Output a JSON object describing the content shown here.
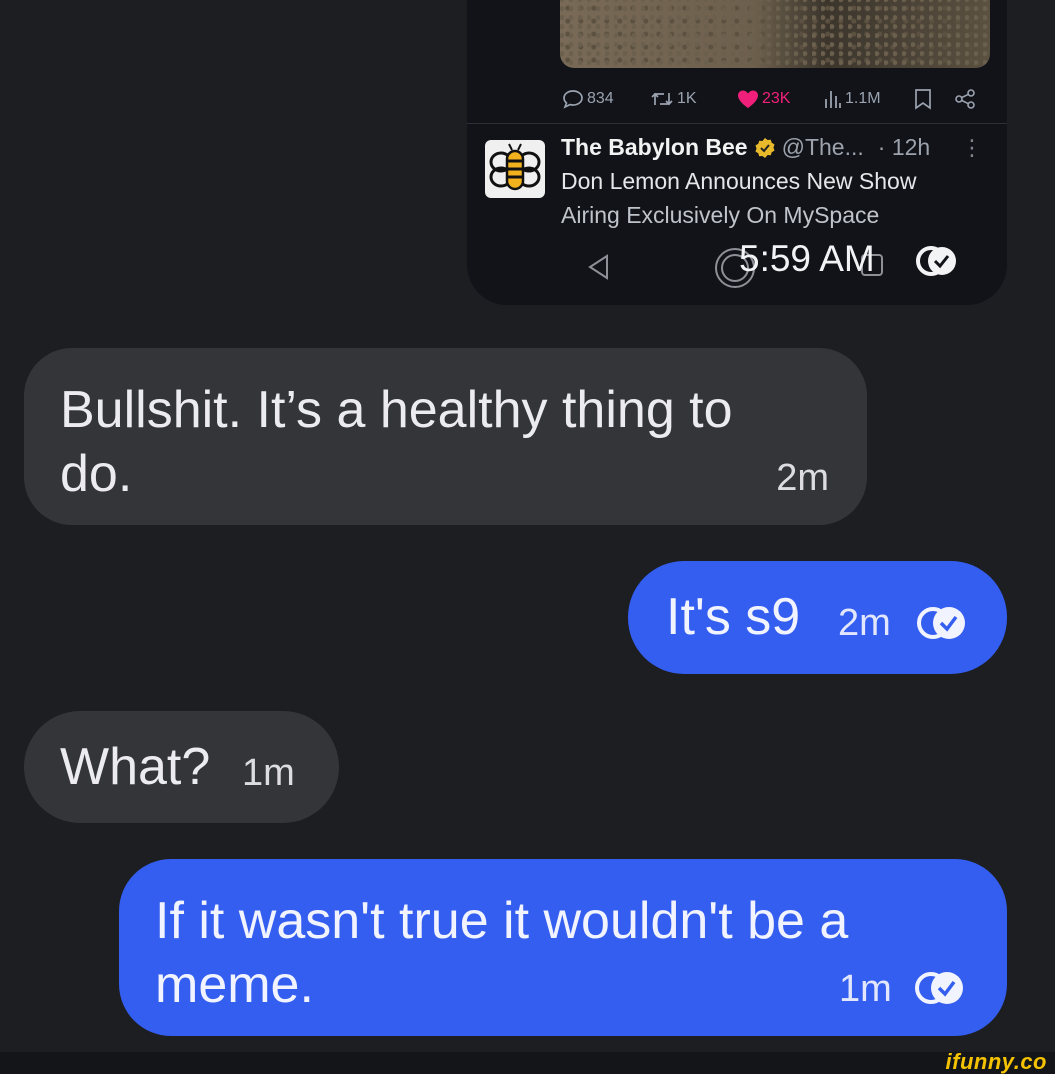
{
  "screenshot_tweet": {
    "engagement": {
      "replies": "834",
      "reposts": "1K",
      "likes": "23K",
      "views": "1.1M"
    },
    "author_name": "The Babylon Bee",
    "author_handle": "@The...",
    "age": "· 12h",
    "more": "⋮",
    "text_line1": "Don Lemon Announces New Show",
    "text_line2": "Airing Exclusively On MySpace",
    "time": "5:59 AM"
  },
  "messages": [
    {
      "direction": "incoming",
      "line1": "Bullshit.  It’s a healthy thing to",
      "line2": "do.",
      "time": "2m"
    },
    {
      "direction": "outgoing",
      "text": "It's s9",
      "time": "2m"
    },
    {
      "direction": "incoming",
      "text": "What?",
      "time": "1m"
    },
    {
      "direction": "outgoing",
      "line1": "If it wasn't true it wouldn't be a",
      "line2": "meme.",
      "time": "1m"
    }
  ],
  "watermark": "ifunny.co",
  "colors": {
    "background": "#1d1e22",
    "incoming_bubble": "#343538",
    "outgoing_bubble": "#345ef0",
    "like_pink": "#f0207a",
    "watermark": "#f4c200"
  },
  "icons": [
    "reply-icon",
    "repost-icon",
    "heart-icon",
    "views-icon",
    "bookmark-icon",
    "share-icon",
    "verified-badge-icon",
    "back-icon",
    "home-icon",
    "recents-icon",
    "read-receipt-icon"
  ]
}
